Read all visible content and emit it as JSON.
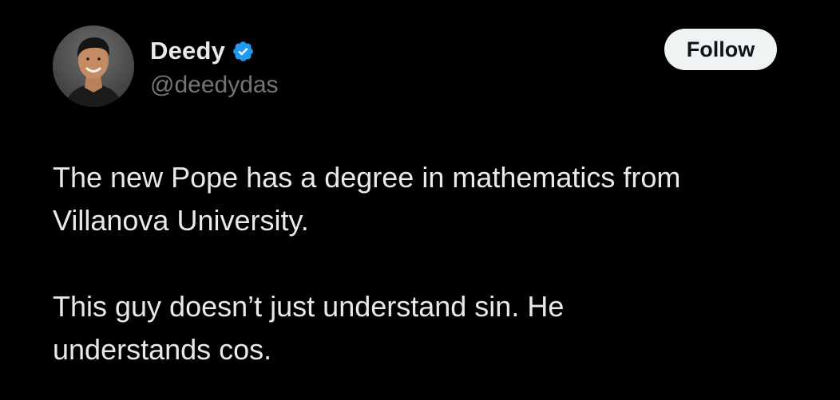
{
  "author": {
    "display_name": "Deedy",
    "handle": "@deedydas",
    "verified": true,
    "verified_badge_color": "#1d9bf0"
  },
  "actions": {
    "follow_label": "Follow"
  },
  "tweet": {
    "paragraphs": [
      "The new Pope has a degree in mathematics from\nVillanova University.",
      "This guy doesn’t just understand sin. He\nunderstands cos."
    ]
  },
  "theme": {
    "background": "#000000",
    "text_primary": "#e7e9ea",
    "text_secondary": "#71767b",
    "button_bg": "#eff3f4"
  }
}
